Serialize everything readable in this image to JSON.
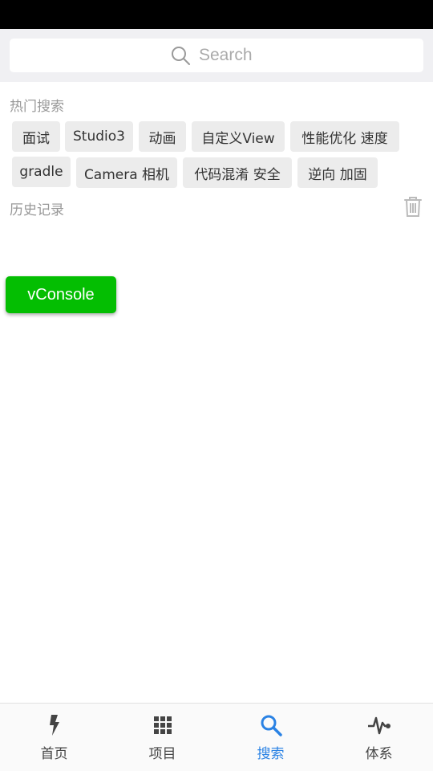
{
  "search": {
    "placeholder": "Search"
  },
  "hot": {
    "title": "热门搜索",
    "tags": [
      "面试",
      "Studio3",
      "动画",
      "自定义View",
      "性能优化 速度",
      "gradle",
      "Camera 相机",
      "代码混淆 安全",
      "逆向 加固"
    ]
  },
  "history": {
    "title": "历史记录"
  },
  "vconsole": {
    "label": "vConsole"
  },
  "nav": {
    "items": [
      {
        "label": "首页",
        "icon": "flash-icon"
      },
      {
        "label": "项目",
        "icon": "grid-icon"
      },
      {
        "label": "搜索",
        "icon": "search-icon"
      },
      {
        "label": "体系",
        "icon": "pulse-icon"
      }
    ],
    "active_index": 2
  },
  "colors": {
    "accent": "#2a82e4",
    "vconsole": "#04be02",
    "tag_bg": "#ececec"
  }
}
